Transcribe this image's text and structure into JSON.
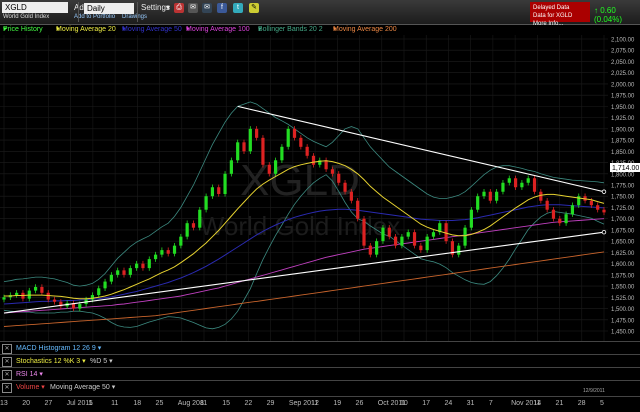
{
  "toolbar": {
    "symbol": "XGLD",
    "subtitle": "World Gold Index",
    "add_indicator": "Add Indicator",
    "add_to_portfolio": "Add to Portfolio",
    "drawings": "Drawings",
    "interval": "Daily",
    "settings": "Settings",
    "delayed_line1": "Delayed Data",
    "delayed_line2": "Data for XGLD",
    "delayed_line3": "More Info...",
    "price_change": "0.60 (0.04%)",
    "icons": [
      "print-icon",
      "email-icon",
      "facebook-icon",
      "twitter-icon",
      "note-icon"
    ]
  },
  "legend": {
    "price_history": "Price History",
    "ma20": "Moving Average 20",
    "ma50": "Moving Average 50",
    "ma100": "Moving Average 100",
    "bollinger": "Bollinger Bands 20 2",
    "ma200": "Moving Average 200"
  },
  "watermark": {
    "symbol": "XGLD",
    "name": "World Gold Index"
  },
  "last_price_label": "1,714.00",
  "panels": [
    {
      "name": "MACD Histogram 12 26 9",
      "extra": ""
    },
    {
      "name": "Stochastics 12 %K 3",
      "extra": "%D 5"
    },
    {
      "name": "RSI 14",
      "extra": ""
    },
    {
      "name": "Volume",
      "extra": "Moving Average 50"
    }
  ],
  "date_label": "12/9/2011",
  "x_ticks": [
    {
      "label": "13",
      "pos": 0
    },
    {
      "label": "20",
      "pos": 1
    },
    {
      "label": "27",
      "pos": 2
    },
    {
      "label": "Jul 2011",
      "pos": 3
    },
    {
      "label": "5",
      "pos": 4
    },
    {
      "label": "11",
      "pos": 5
    },
    {
      "label": "18",
      "pos": 6
    },
    {
      "label": "25",
      "pos": 7
    },
    {
      "label": "Aug 2011",
      "pos": 8
    },
    {
      "label": "8",
      "pos": 9
    },
    {
      "label": "15",
      "pos": 10
    },
    {
      "label": "22",
      "pos": 11
    },
    {
      "label": "29",
      "pos": 12
    },
    {
      "label": "Sep 2011",
      "pos": 13
    },
    {
      "label": "12",
      "pos": 14
    },
    {
      "label": "19",
      "pos": 15
    },
    {
      "label": "26",
      "pos": 16
    },
    {
      "label": "Oct 2011",
      "pos": 17
    },
    {
      "label": "10",
      "pos": 18
    },
    {
      "label": "17",
      "pos": 19
    },
    {
      "label": "24",
      "pos": 20
    },
    {
      "label": "31",
      "pos": 21
    },
    {
      "label": "7",
      "pos": 22
    },
    {
      "label": "Nov 2011",
      "pos": 23
    },
    {
      "label": "14",
      "pos": 24
    },
    {
      "label": "21",
      "pos": 25
    },
    {
      "label": "28",
      "pos": 26
    },
    {
      "label": "5",
      "pos": 27
    }
  ],
  "chart_data": {
    "type": "line",
    "y_ticks": [
      "2,100.00",
      "2,075.00",
      "2,050.00",
      "2,025.00",
      "2,000.00",
      "1,975.00",
      "1,950.00",
      "1,925.00",
      "1,900.00",
      "1,875.00",
      "1,850.00",
      "1,825.00",
      "1,800.00",
      "1,775.00",
      "1,750.00",
      "1,725.00",
      "1,700.00",
      "1,675.00",
      "1,650.00",
      "1,625.00",
      "1,600.00",
      "1,575.00",
      "1,550.00",
      "1,525.00",
      "1,500.00",
      "1,475.00",
      "1,450.00"
    ],
    "ylim": [
      1450,
      2100
    ],
    "close": [
      1525,
      1530,
      1535,
      1522,
      1540,
      1548,
      1535,
      1520,
      1515,
      1505,
      1512,
      1500,
      1510,
      1520,
      1530,
      1545,
      1560,
      1575,
      1585,
      1575,
      1590,
      1600,
      1590,
      1610,
      1620,
      1630,
      1622,
      1640,
      1660,
      1690,
      1680,
      1720,
      1750,
      1770,
      1755,
      1800,
      1830,
      1870,
      1850,
      1900,
      1880,
      1820,
      1800,
      1830,
      1860,
      1900,
      1880,
      1860,
      1840,
      1820,
      1830,
      1810,
      1800,
      1780,
      1760,
      1740,
      1700,
      1640,
      1620,
      1650,
      1680,
      1660,
      1640,
      1660,
      1670,
      1640,
      1630,
      1660,
      1670,
      1690,
      1650,
      1620,
      1640,
      1680,
      1720,
      1750,
      1760,
      1740,
      1760,
      1780,
      1790,
      1770,
      1780,
      1790,
      1760,
      1740,
      1720,
      1700,
      1690,
      1710,
      1730,
      1750,
      1740,
      1730,
      1720,
      1714
    ],
    "ma20": [
      1528,
      1528,
      1529,
      1529,
      1530,
      1530,
      1530,
      1529,
      1528,
      1527,
      1525,
      1523,
      1522,
      1522,
      1523,
      1525,
      1528,
      1532,
      1537,
      1542,
      1548,
      1554,
      1560,
      1566,
      1573,
      1580,
      1586,
      1593,
      1602,
      1612,
      1622,
      1634,
      1646,
      1660,
      1674,
      1690,
      1706,
      1722,
      1737,
      1752,
      1766,
      1777,
      1786,
      1794,
      1802,
      1810,
      1816,
      1820,
      1823,
      1826,
      1828,
      1829,
      1827,
      1823,
      1818,
      1810,
      1800,
      1787,
      1772,
      1760,
      1748,
      1738,
      1728,
      1718,
      1708,
      1698,
      1688,
      1681,
      1676,
      1672,
      1668,
      1664,
      1662,
      1662,
      1665,
      1670,
      1676,
      1684,
      1694,
      1704,
      1714,
      1724,
      1733,
      1742,
      1748,
      1752,
      1754,
      1754,
      1752,
      1750,
      1748,
      1746,
      1744,
      1742,
      1738,
      1734
    ],
    "ma50": [
      1510,
      1511,
      1512,
      1513,
      1514,
      1515,
      1516,
      1516,
      1517,
      1517,
      1518,
      1518,
      1519,
      1520,
      1521,
      1522,
      1524,
      1526,
      1529,
      1532,
      1535,
      1538,
      1542,
      1546,
      1550,
      1554,
      1558,
      1563,
      1568,
      1574,
      1580,
      1587,
      1594,
      1602,
      1610,
      1619,
      1628,
      1637,
      1646,
      1655,
      1664,
      1672,
      1679,
      1686,
      1692,
      1698,
      1703,
      1707,
      1711,
      1714,
      1717,
      1719,
      1720,
      1721,
      1721,
      1720,
      1719,
      1717,
      1715,
      1713,
      1711,
      1709,
      1707,
      1705,
      1703,
      1701,
      1699,
      1698,
      1697,
      1696,
      1696,
      1696,
      1697,
      1698,
      1700,
      1702,
      1705,
      1708,
      1711,
      1714,
      1717,
      1720,
      1723,
      1726,
      1728,
      1730,
      1731,
      1731,
      1731,
      1730,
      1729,
      1728,
      1727,
      1726,
      1725,
      1724
    ],
    "ma100": [
      1490,
      1491,
      1492,
      1493,
      1494,
      1495,
      1496,
      1497,
      1498,
      1499,
      1500,
      1501,
      1502,
      1503,
      1504,
      1505,
      1506,
      1507,
      1509,
      1510,
      1512,
      1514,
      1516,
      1518,
      1520,
      1522,
      1524,
      1526,
      1528,
      1531,
      1534,
      1537,
      1540,
      1543,
      1546,
      1550,
      1554,
      1558,
      1562,
      1566,
      1570,
      1574,
      1578,
      1582,
      1586,
      1590,
      1594,
      1598,
      1602,
      1606,
      1610,
      1614,
      1617,
      1620,
      1623,
      1626,
      1629,
      1632,
      1634,
      1636,
      1638,
      1640,
      1642,
      1644,
      1646,
      1648,
      1650,
      1652,
      1654,
      1656,
      1658,
      1660,
      1662,
      1664,
      1666,
      1668,
      1670,
      1672,
      1674,
      1676,
      1678,
      1680,
      1682,
      1684,
      1686,
      1688,
      1690,
      1692,
      1693,
      1694,
      1695,
      1696,
      1697,
      1698,
      1699,
      1700
    ],
    "ma200": [
      1460,
      1461,
      1462,
      1463,
      1464,
      1465,
      1466,
      1467,
      1468,
      1469,
      1470,
      1471,
      1472,
      1473,
      1474,
      1475,
      1476,
      1477,
      1478,
      1479,
      1480,
      1481,
      1482,
      1483,
      1484,
      1486,
      1488,
      1490,
      1492,
      1494,
      1496,
      1498,
      1500,
      1502,
      1504,
      1506,
      1508,
      1510,
      1512,
      1514,
      1516,
      1518,
      1520,
      1522,
      1524,
      1526,
      1528,
      1530,
      1532,
      1534,
      1536,
      1538,
      1540,
      1542,
      1544,
      1546,
      1548,
      1550,
      1552,
      1554,
      1556,
      1558,
      1560,
      1562,
      1564,
      1566,
      1568,
      1570,
      1572,
      1574,
      1576,
      1578,
      1580,
      1582,
      1584,
      1586,
      1588,
      1590,
      1592,
      1594,
      1596,
      1598,
      1600,
      1602,
      1604,
      1606,
      1608,
      1610,
      1612,
      1614,
      1616,
      1618,
      1620,
      1622,
      1624,
      1626
    ],
    "bb_upper": [
      1560,
      1562,
      1565,
      1566,
      1568,
      1570,
      1570,
      1568,
      1566,
      1562,
      1558,
      1552,
      1550,
      1552,
      1556,
      1565,
      1578,
      1595,
      1612,
      1625,
      1638,
      1648,
      1655,
      1662,
      1672,
      1682,
      1690,
      1705,
      1725,
      1750,
      1775,
      1805,
      1835,
      1865,
      1890,
      1915,
      1935,
      1950,
      1955,
      1960,
      1955,
      1945,
      1935,
      1925,
      1918,
      1910,
      1900,
      1890,
      1880,
      1872,
      1866,
      1860,
      1870,
      1885,
      1900,
      1905,
      1900,
      1880,
      1860,
      1845,
      1830,
      1815,
      1805,
      1795,
      1785,
      1775,
      1765,
      1755,
      1748,
      1745,
      1745,
      1748,
      1752,
      1760,
      1772,
      1785,
      1798,
      1808,
      1815,
      1818,
      1818,
      1815,
      1812,
      1808,
      1805,
      1800,
      1796,
      1792,
      1790,
      1788,
      1786,
      1785,
      1784,
      1783,
      1782,
      1780
    ],
    "bb_lower": [
      1496,
      1494,
      1493,
      1492,
      1492,
      1490,
      1490,
      1490,
      1490,
      1492,
      1492,
      1494,
      1494,
      1492,
      1490,
      1485,
      1478,
      1469,
      1462,
      1459,
      1458,
      1460,
      1465,
      1470,
      1474,
      1478,
      1482,
      1481,
      1479,
      1474,
      1469,
      1463,
      1457,
      1455,
      1458,
      1465,
      1477,
      1494,
      1519,
      1544,
      1577,
      1609,
      1637,
      1663,
      1686,
      1710,
      1732,
      1750,
      1766,
      1780,
      1790,
      1798,
      1784,
      1761,
      1736,
      1715,
      1700,
      1694,
      1684,
      1675,
      1666,
      1661,
      1651,
      1641,
      1631,
      1621,
      1611,
      1607,
      1604,
      1599,
      1591,
      1580,
      1572,
      1564,
      1558,
      1555,
      1554,
      1560,
      1573,
      1590,
      1610,
      1633,
      1654,
      1676,
      1691,
      1704,
      1712,
      1716,
      1714,
      1712,
      1710,
      1707,
      1704,
      1701,
      1694,
      1688
    ],
    "trendlines": [
      {
        "from": [
          0,
          1490
        ],
        "to": [
          95,
          1670
        ]
      },
      {
        "from": [
          37,
          1950
        ],
        "to": [
          95,
          1760
        ]
      }
    ],
    "grid": true
  }
}
